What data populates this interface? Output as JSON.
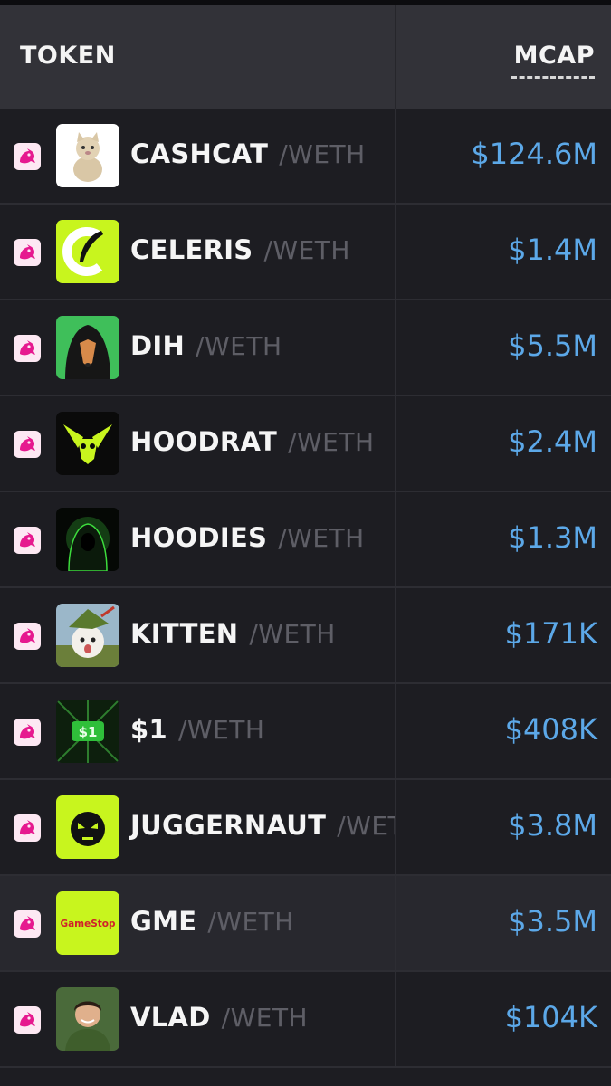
{
  "header": {
    "token_label": "TOKEN",
    "mcap_label": "MCAP"
  },
  "colors": {
    "mcap_text": "#5ca8e8",
    "pair_text": "#5e5e66",
    "dex_badge": "#e6198f",
    "lime": "#c8f51e"
  },
  "rows": [
    {
      "name": "CASHCAT",
      "pair": "/WETH",
      "mcap": "$124.6M",
      "logo_icon": "cat-icon"
    },
    {
      "name": "CELERIS",
      "pair": "/WETH",
      "mcap": "$1.4M",
      "logo_icon": "feather-icon"
    },
    {
      "name": "DIH",
      "pair": "/WETH",
      "mcap": "$5.5M",
      "logo_icon": "hooded-dog-icon"
    },
    {
      "name": "HOODRAT",
      "pair": "/WETH",
      "mcap": "$2.4M",
      "logo_icon": "rat-icon"
    },
    {
      "name": "HOODIES",
      "pair": "/WETH",
      "mcap": "$1.3M",
      "logo_icon": "hooded-figure-icon"
    },
    {
      "name": "KITTEN",
      "pair": "/WETH",
      "mcap": "$171K",
      "logo_icon": "kitten-icon"
    },
    {
      "name": "$1",
      "pair": "/WETH",
      "mcap": "$408K",
      "logo_icon": "dollar-sign-icon"
    },
    {
      "name": "JUGGERNAUT",
      "pair": "/WETH",
      "mcap": "$3.8M",
      "logo_icon": "angry-face-icon"
    },
    {
      "name": "GME",
      "pair": "/WETH",
      "mcap": "$3.5M",
      "logo_icon": "gamestop-logo-icon",
      "logo_text": "GameStop"
    },
    {
      "name": "VLAD",
      "pair": "/WETH",
      "mcap": "$104K",
      "logo_icon": "portrait-icon"
    }
  ]
}
